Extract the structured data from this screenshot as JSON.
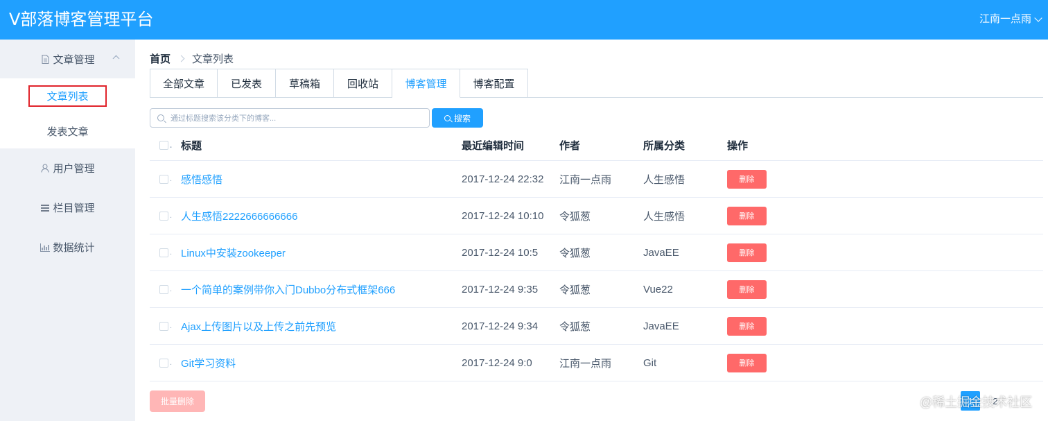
{
  "app": {
    "title": "V部落博客管理平台",
    "user": "江南一点雨"
  },
  "sidebar": {
    "groups": [
      {
        "label": "文章管理",
        "icon": "document-icon"
      },
      {
        "label": "用户管理",
        "icon": "user-icon"
      },
      {
        "label": "栏目管理",
        "icon": "menu-lines-icon"
      },
      {
        "label": "数据统计",
        "icon": "bar-chart-icon"
      }
    ],
    "subitems": [
      {
        "label": "文章列表",
        "active": true
      },
      {
        "label": "发表文章",
        "active": false
      }
    ]
  },
  "breadcrumb": {
    "home": "首页",
    "current": "文章列表"
  },
  "tabs": [
    "全部文章",
    "已发表",
    "草稿箱",
    "回收站",
    "博客管理",
    "博客配置"
  ],
  "active_tab": "博客管理",
  "search": {
    "placeholder": "通过标题搜索该分类下的博客...",
    "button": "搜索"
  },
  "table": {
    "headers": {
      "title": "标题",
      "time": "最近编辑时间",
      "author": "作者",
      "category": "所属分类",
      "ops": "操作"
    },
    "rows": [
      {
        "title": "感悟感悟",
        "time": "2017-12-24 22:32",
        "author": "江南一点雨",
        "category": "人生感悟",
        "action": "删除"
      },
      {
        "title": "人生感悟2222666666666",
        "time": "2017-12-24 10:10",
        "author": "令狐葱",
        "category": "人生感悟",
        "action": "删除"
      },
      {
        "title": "Linux中安装zookeeper",
        "time": "2017-12-24 10:5",
        "author": "令狐葱",
        "category": "JavaEE",
        "action": "删除"
      },
      {
        "title": "一个简单的案例带你入门Dubbo分布式框架666",
        "time": "2017-12-24 9:35",
        "author": "令狐葱",
        "category": "Vue22",
        "action": "删除"
      },
      {
        "title": "Ajax上传图片以及上传之前先预览",
        "time": "2017-12-24 9:34",
        "author": "令狐葱",
        "category": "JavaEE",
        "action": "删除"
      },
      {
        "title": "Git学习资料",
        "time": "2017-12-24 9:0",
        "author": "江南一点雨",
        "category": "Git",
        "action": "删除"
      }
    ]
  },
  "batch_delete": "批量删除",
  "pagination": {
    "pages": [
      "1",
      "2"
    ],
    "current": "1"
  },
  "watermark": "@稀土掘金技术社区",
  "colors": {
    "primary": "#20a0ff",
    "danger": "#ff4949",
    "sidebar_bg": "#eef1f6"
  }
}
